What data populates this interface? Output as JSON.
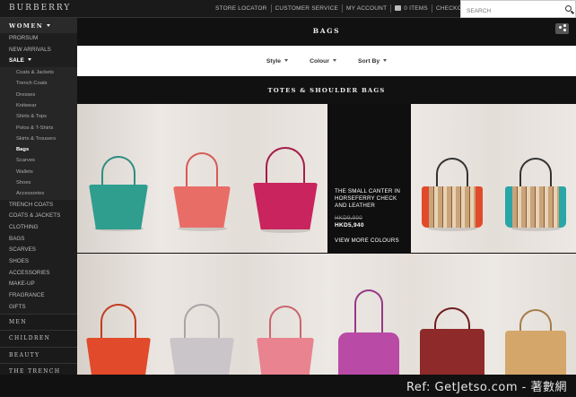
{
  "brand": "BURBERRY",
  "top_nav": {
    "links": [
      "STORE LOCATOR",
      "CUSTOMER SERVICE",
      "MY ACCOUNT"
    ],
    "bag_count": "0 ITEMS",
    "checkout": "CHECKOUT"
  },
  "search": {
    "placeholder": "SEARCH"
  },
  "sidebar": {
    "header": "WOMEN",
    "top_items": [
      "PRORSUM",
      "NEW ARRIVALS"
    ],
    "sale_label": "SALE",
    "sale_subitems": [
      "Coats & Jackets",
      "Trench Coats",
      "Dresses",
      "Knitwear",
      "Shirts & Tops",
      "Polos & T-Shirts",
      "Skirts & Trousers",
      "Bags",
      "Scarves",
      "Wallets",
      "Shoes",
      "Accessories"
    ],
    "active_subitem": "Bags",
    "main_items": [
      "TRENCH COATS",
      "COATS & JACKETS",
      "CLOTHING",
      "BAGS",
      "SCARVES",
      "SHOES",
      "ACCESSORIES",
      "MAKE-UP",
      "FRAGRANCE",
      "GIFTS"
    ],
    "categories": [
      "MEN",
      "CHILDREN",
      "BEAUTY",
      "THE TRENCH"
    ]
  },
  "page": {
    "title": "BAGS",
    "filters": [
      "Style",
      "Colour",
      "Sort By"
    ],
    "section_title": "TOTES & SHOULDER BAGS"
  },
  "overlay": {
    "name": "THE SMALL CANTER IN HORSEFERRY CHECK AND LEATHER",
    "old_price": "HKD9,900",
    "price": "HKD5,940",
    "link": "VIEW MORE COLOURS"
  },
  "colors": {
    "teal": "#2f9e8f",
    "coral": "#e96d67",
    "fuchsia": "#c9245d",
    "check": "#c9a47a",
    "check_teal": "#2aa6a6",
    "orange": "#e14a2a",
    "grey": "#c9c5c8",
    "pink": "#e8838f",
    "purple": "#b94aa6",
    "oxblood": "#8e2a2a",
    "tan": "#d4a66a"
  },
  "watermark": "Ref: GetJetso.com - 著數網"
}
